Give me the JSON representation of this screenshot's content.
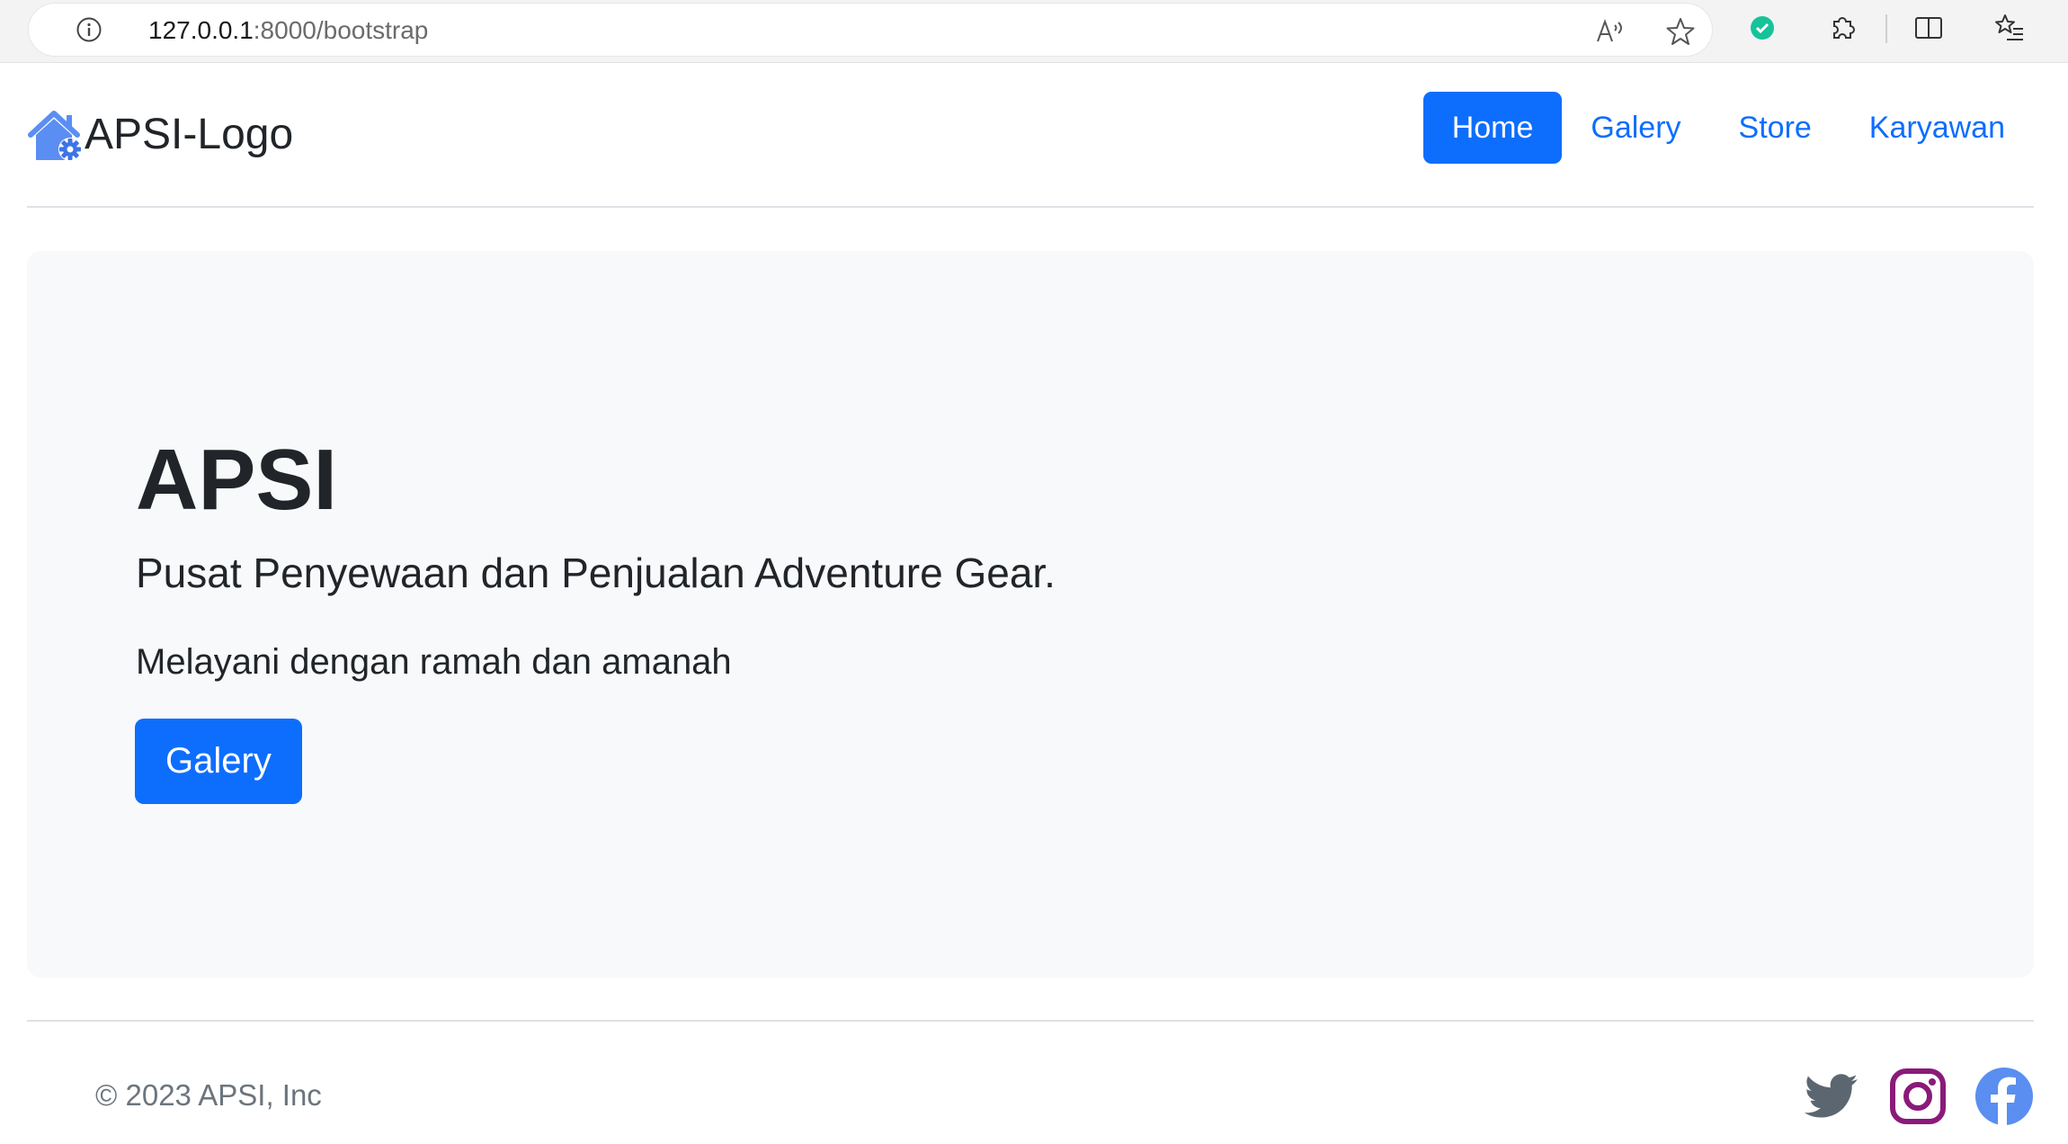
{
  "browser": {
    "url_host": "127.0.0.1",
    "url_rest": ":8000/bootstrap",
    "icons": [
      "info-icon",
      "read-aloud-icon",
      "favorite-star-icon",
      "extension-grammarly-icon",
      "extensions-puzzle-icon",
      "split-screen-icon",
      "favorites-list-icon"
    ]
  },
  "navbar": {
    "brand": "APSI-Logo",
    "brand_icon": "house-gear-icon",
    "links": [
      {
        "label": "Home",
        "active": true
      },
      {
        "label": "Galery",
        "active": false
      },
      {
        "label": "Store",
        "active": false
      },
      {
        "label": "Karyawan",
        "active": false
      }
    ]
  },
  "hero": {
    "title": "APSI",
    "lead": "Pusat Penyewaan dan Penjualan Adventure Gear.",
    "text": "Melayani dengan ramah dan amanah",
    "button_label": "Galery"
  },
  "footer": {
    "copyright": "© 2023 APSI, Inc",
    "socials": [
      "twitter-icon",
      "instagram-icon",
      "facebook-icon"
    ]
  },
  "colors": {
    "primary": "#0d6efd",
    "hero_bg": "#f8f9fa",
    "text": "#212529",
    "muted": "#6c757d",
    "twitter": "#5c6670",
    "instagram": "#8a1a7a",
    "facebook": "#5a8ef0"
  }
}
